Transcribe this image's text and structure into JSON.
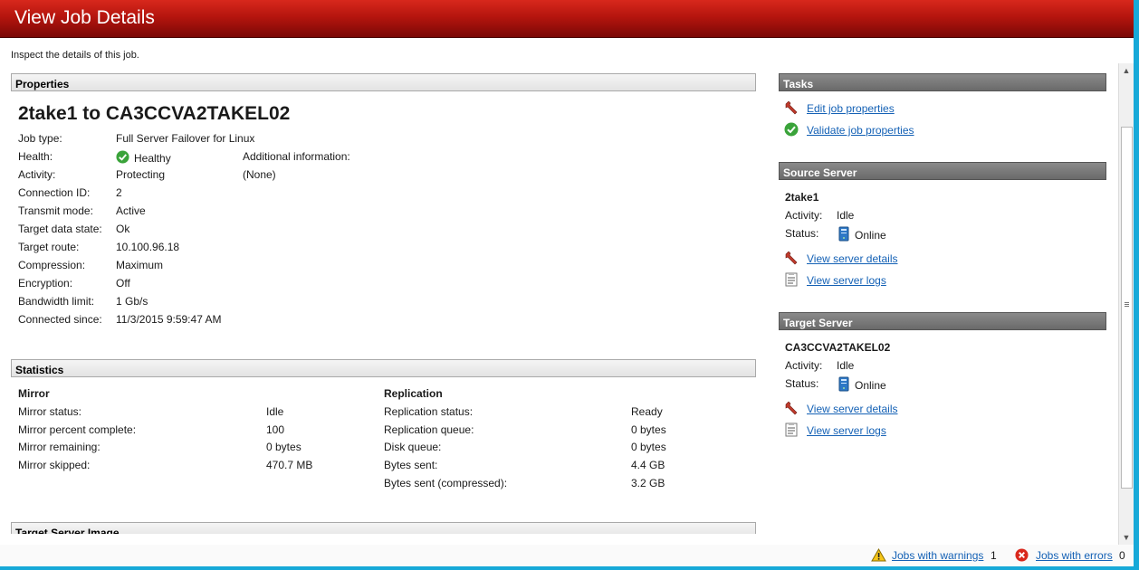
{
  "window": {
    "title": "View Job Details",
    "intro": "Inspect the details of this job."
  },
  "properties": {
    "header": "Properties",
    "job_name": "2take1 to CA3CCVA2TAKEL02",
    "rows": [
      {
        "label": "Job type:",
        "value": "Full Server Failover for Linux"
      },
      {
        "label": "Health:",
        "value": "Healthy"
      },
      {
        "label": "Activity:",
        "value": "Protecting"
      },
      {
        "label": "Connection ID:",
        "value": "2"
      },
      {
        "label": "Transmit mode:",
        "value": "Active"
      },
      {
        "label": "Target data state:",
        "value": "Ok"
      },
      {
        "label": "Target route:",
        "value": "10.100.96.18"
      },
      {
        "label": "Compression:",
        "value": "Maximum"
      },
      {
        "label": "Encryption:",
        "value": "Off"
      },
      {
        "label": "Bandwidth limit:",
        "value": "1 Gb/s"
      },
      {
        "label": "Connected since:",
        "value": "11/3/2015 9:59:47 AM"
      }
    ],
    "additional_label": "Additional information:",
    "additional_value": "(None)"
  },
  "statistics": {
    "header": "Statistics",
    "mirror": {
      "title": "Mirror",
      "rows": [
        {
          "label": "Mirror status:",
          "value": "Idle"
        },
        {
          "label": "Mirror percent complete:",
          "value": "100"
        },
        {
          "label": "Mirror remaining:",
          "value": "0 bytes"
        },
        {
          "label": "Mirror skipped:",
          "value": "470.7 MB"
        }
      ]
    },
    "replication": {
      "title": "Replication",
      "rows": [
        {
          "label": "Replication status:",
          "value": "Ready"
        },
        {
          "label": "Replication queue:",
          "value": "0 bytes"
        },
        {
          "label": "Disk queue:",
          "value": "0 bytes"
        },
        {
          "label": "Bytes sent:",
          "value": "4.4 GB"
        },
        {
          "label": "Bytes sent (compressed):",
          "value": "3.2 GB"
        }
      ]
    }
  },
  "target_image": {
    "header": "Target Server Image"
  },
  "tasks": {
    "header": "Tasks",
    "items": [
      {
        "label": "Edit job properties",
        "icon": "wrench-icon"
      },
      {
        "label": "Validate job properties",
        "icon": "check-icon"
      }
    ]
  },
  "source_server": {
    "header": "Source Server",
    "name": "2take1",
    "activity_label": "Activity:",
    "activity": "Idle",
    "status_label": "Status:",
    "status": "Online",
    "links": [
      "View server details",
      "View server logs"
    ]
  },
  "target_server": {
    "header": "Target Server",
    "name": "CA3CCVA2TAKEL02",
    "activity_label": "Activity:",
    "activity": "Idle",
    "status_label": "Status:",
    "status": "Online",
    "links": [
      "View server details",
      "View server logs"
    ]
  },
  "statusbar": {
    "warnings_label": "Jobs with warnings",
    "warnings_count": "1",
    "errors_label": "Jobs with errors",
    "errors_count": "0"
  },
  "colors": {
    "title_red": "#b5150e",
    "link_blue": "#1461b5",
    "accent_cyan": "#17a9d8"
  }
}
